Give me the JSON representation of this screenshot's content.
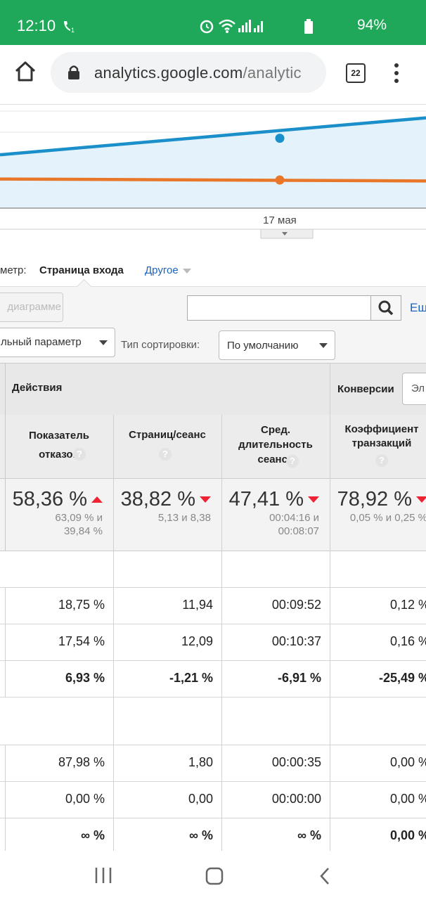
{
  "status_bar": {
    "time": "12:10",
    "battery": "94%"
  },
  "browser": {
    "url_main": "analytics.google.com",
    "url_rest": "/analytic",
    "tab_count": "22"
  },
  "chart_data": {
    "type": "line",
    "x_tick_label": "17 мая",
    "series": [
      {
        "color": "#1a8fc9",
        "values": [
          0.55,
          0.72,
          0.93
        ]
      },
      {
        "color": "#e8772a",
        "values": [
          0.3,
          0.29,
          0.28
        ]
      }
    ]
  },
  "toolbar": {
    "dimension_prefix": "метр:",
    "dimension_value": "Страница входа",
    "other_link": "Другое",
    "chart_button": "диаграмме",
    "search_placeholder": "",
    "more_link": "Ещ",
    "secondary_param": "льный параметр",
    "sort_label": "Тип сортировки:",
    "sort_value": "По умолчанию"
  },
  "table": {
    "group_actions": "Действия",
    "group_conversions": "Конверсии",
    "conversions_select": "Эл",
    "col1": "Показатель отказов",
    "col2": "Страниц/сеанс",
    "col3": "Сред. длительность сеанса",
    "col4": "Коэффициент транзакций",
    "totals": [
      {
        "big": "58,36 %",
        "sub1": "63,09 % и",
        "sub2": "39,84 %",
        "dir": "up"
      },
      {
        "big": "38,82 %",
        "sub1": "5,13 и 8,38",
        "sub2": "",
        "dir": "down"
      },
      {
        "big": "47,41 %",
        "sub1": "00:04:16 и",
        "sub2": "00:08:07",
        "dir": "down"
      },
      {
        "big": "78,92 %",
        "sub1": "0,05 % и 0,25 %",
        "sub2": "",
        "dir": "down"
      }
    ],
    "rows_a": [
      [
        "18,75 %",
        "11,94",
        "00:09:52",
        "0,12 %"
      ],
      [
        "17,54 %",
        "12,09",
        "00:10:37",
        "0,16 %"
      ],
      [
        "6,93 %",
        "-1,21 %",
        "-6,91 %",
        "-25,49 %"
      ]
    ],
    "rows_b": [
      [
        "87,98 %",
        "1,80",
        "00:00:35",
        "0,00 %"
      ],
      [
        "0,00 %",
        "0,00",
        "00:00:00",
        "0,00 %"
      ],
      [
        "∞ %",
        "∞ %",
        "∞ %",
        "0,00 %"
      ]
    ]
  }
}
